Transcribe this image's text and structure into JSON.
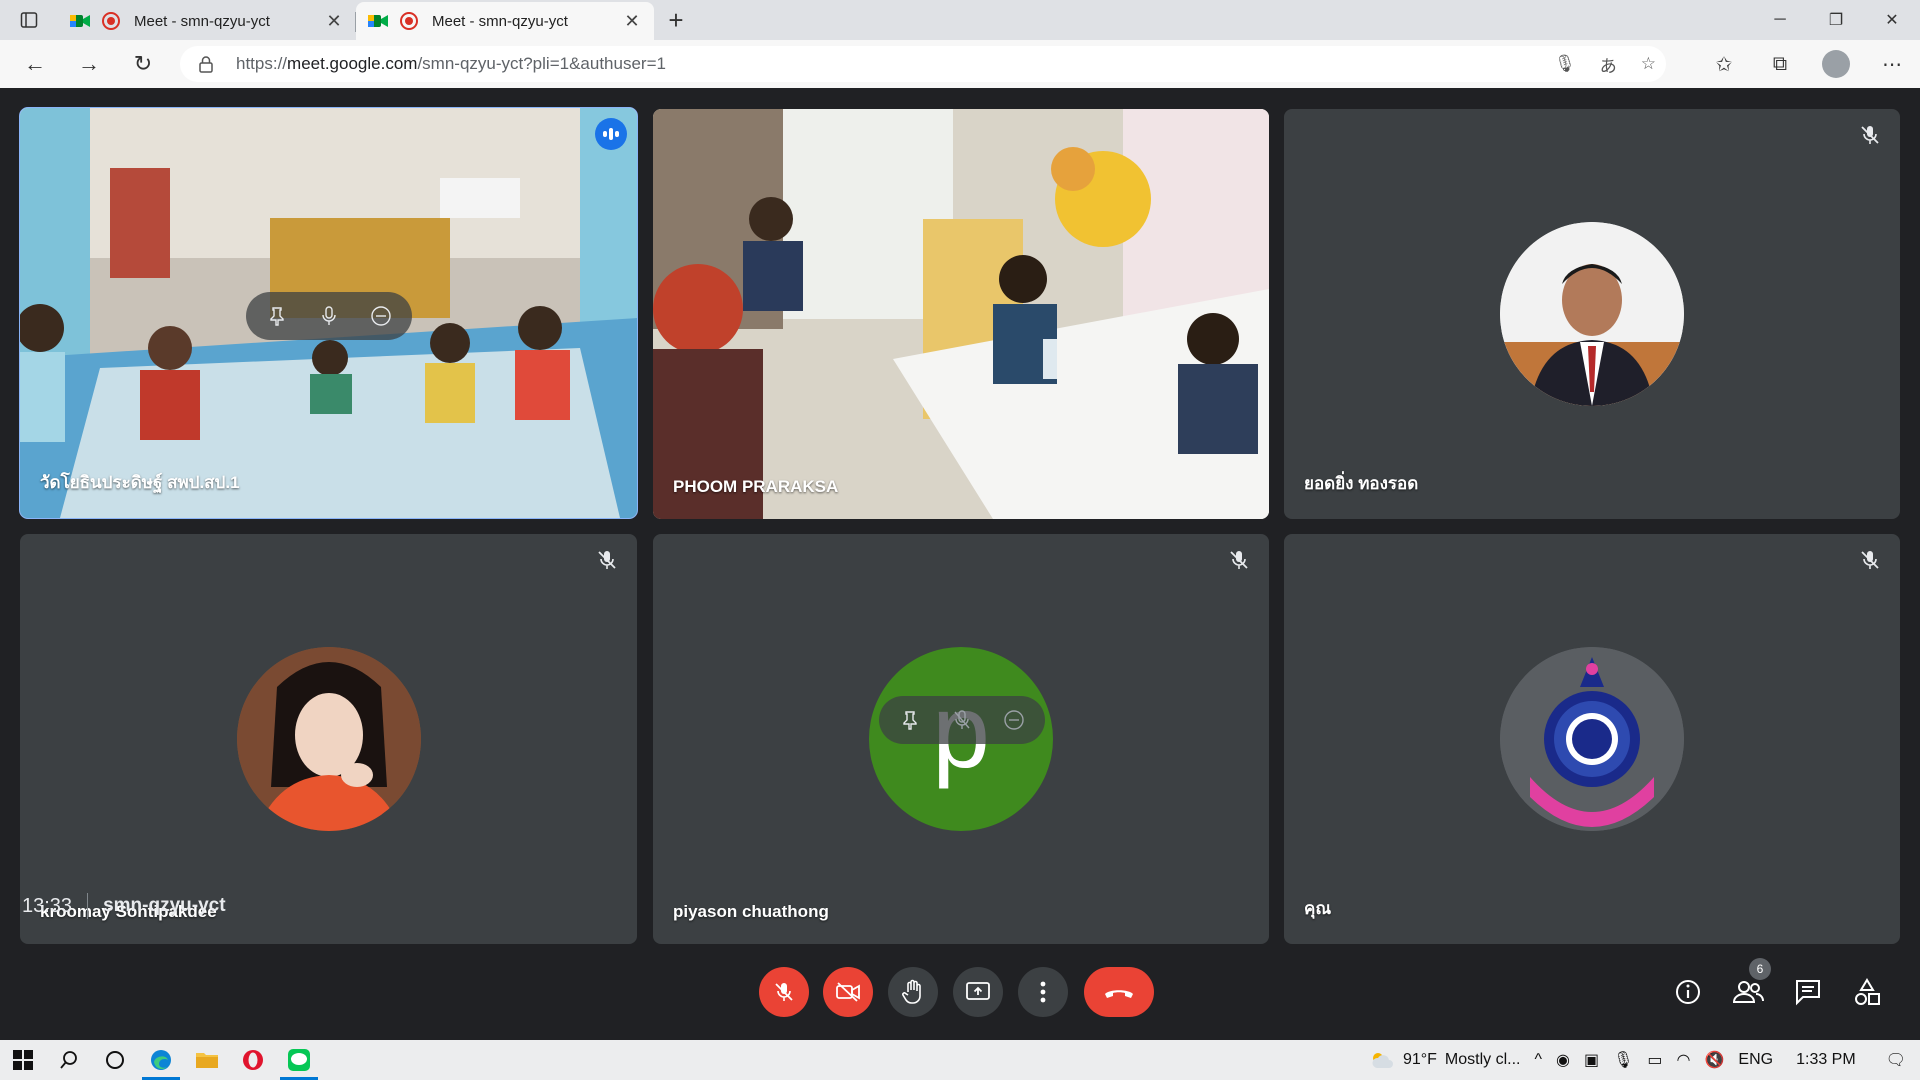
{
  "browser": {
    "tabs": [
      {
        "title": "Meet - smn-qzyu-yct",
        "active": false
      },
      {
        "title": "Meet - smn-qzyu-yct",
        "active": true
      }
    ],
    "url_prefix": "https://",
    "url_host": "meet.google.com",
    "url_path": "/smn-qzyu-yct?pli=1&authuser=1"
  },
  "participants": [
    {
      "name": "วัดโยธินประดิษฐ์ สพป.สป.1",
      "type": "video",
      "speaking": true
    },
    {
      "name": "PHOOM PRARAKSA",
      "type": "video"
    },
    {
      "name": "ยอดยิ่ง ทองรอด",
      "type": "photo",
      "muted": true
    },
    {
      "name": "kroomay Sontipakdee",
      "type": "photo",
      "muted": true
    },
    {
      "name": "piyason chuathong",
      "type": "initial",
      "initial": "p",
      "avatar_color": "#3f8a1e",
      "muted": true
    },
    {
      "name": "คุณ",
      "type": "logo",
      "muted": true
    }
  ],
  "meeting": {
    "time": "13:33",
    "code": "smn-qzyu-yct",
    "people_count": "6"
  },
  "taskbar": {
    "weather_temp": "91°F",
    "weather_desc": "Mostly cl...",
    "lang": "ENG",
    "clock": "1:33 PM"
  },
  "colors": {
    "stage_bg": "#202124",
    "tile_bg": "#3c4043",
    "danger": "#ea4335",
    "highlight": "#8ab4f8"
  }
}
